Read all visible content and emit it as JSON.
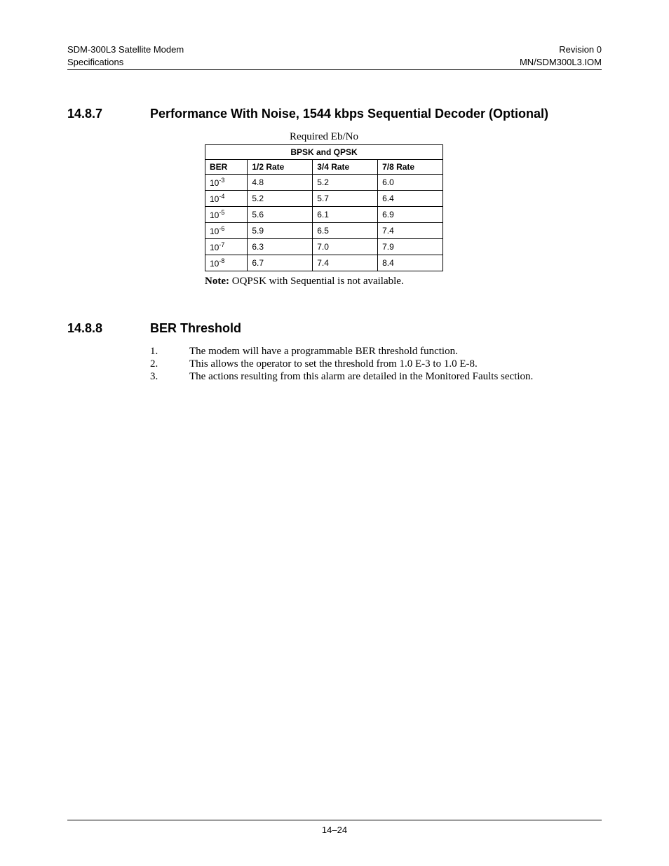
{
  "header": {
    "left_line1": "SDM-300L3 Satellite Modem",
    "left_line2": "Specifications",
    "right_line1": "Revision 0",
    "right_line2": "MN/SDM300L3.IOM"
  },
  "section_14_8_7": {
    "number": "14.8.7",
    "title": "Performance With Noise, 1544 kbps Sequential Decoder (Optional)"
  },
  "table": {
    "caption": "Required Eb/No",
    "span_header": "BPSK and QPSK",
    "columns": [
      "BER",
      "1/2 Rate",
      "3/4 Rate",
      "7/8 Rate"
    ],
    "rows": [
      {
        "ber_base": "10",
        "ber_exp": "-3",
        "half": "4.8",
        "three_quarter": "5.2",
        "seven_eighth": "6.0"
      },
      {
        "ber_base": "10",
        "ber_exp": "-4",
        "half": "5.2",
        "three_quarter": "5.7",
        "seven_eighth": "6.4"
      },
      {
        "ber_base": "10",
        "ber_exp": "-5",
        "half": "5.6",
        "three_quarter": "6.1",
        "seven_eighth": "6.9"
      },
      {
        "ber_base": "10",
        "ber_exp": "-6",
        "half": "5.9",
        "three_quarter": "6.5",
        "seven_eighth": "7.4"
      },
      {
        "ber_base": "10",
        "ber_exp": "-7",
        "half": "6.3",
        "three_quarter": "7.0",
        "seven_eighth": "7.9"
      },
      {
        "ber_base": "10",
        "ber_exp": "-8",
        "half": "6.7",
        "three_quarter": "7.4",
        "seven_eighth": "8.4"
      }
    ],
    "note_label": "Note:",
    "note_text": " OQPSK with Sequential is not available."
  },
  "section_14_8_8": {
    "number": "14.8.8",
    "title": "BER Threshold",
    "items": [
      {
        "num": "1.",
        "text": "The modem will have a programmable BER threshold function."
      },
      {
        "num": "2.",
        "text": "This allows the operator to set the threshold from 1.0 E-3 to 1.0 E-8."
      },
      {
        "num": "3.",
        "text": "The actions resulting from this alarm are detailed in the Monitored Faults section."
      }
    ]
  },
  "footer": {
    "page": "14–24"
  }
}
